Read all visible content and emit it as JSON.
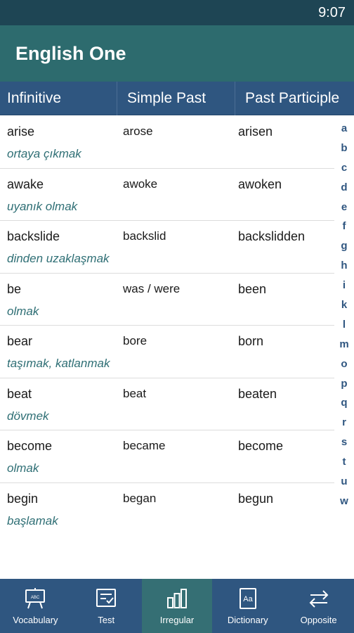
{
  "status_bar": {
    "time": "9:07"
  },
  "app_bar": {
    "title": "English One"
  },
  "columns": {
    "infinitive": "Infinitive",
    "simple_past": "Simple Past",
    "past_participle": "Past Participle"
  },
  "verbs": [
    {
      "infinitive": "arise",
      "simple_past": "arose",
      "past_participle": "arisen",
      "translation": "ortaya çıkmak"
    },
    {
      "infinitive": "awake",
      "simple_past": "awoke",
      "past_participle": "awoken",
      "translation": "uyanık olmak"
    },
    {
      "infinitive": "backslide",
      "simple_past": "backslid",
      "past_participle": "backslidden",
      "translation": "dinden uzaklaşmak"
    },
    {
      "infinitive": "be",
      "simple_past": "was / were",
      "past_participle": "been",
      "translation": "olmak"
    },
    {
      "infinitive": "bear",
      "simple_past": "bore",
      "past_participle": "born",
      "translation": "taşımak, katlanmak"
    },
    {
      "infinitive": "beat",
      "simple_past": "beat",
      "past_participle": "beaten",
      "translation": "dövmek"
    },
    {
      "infinitive": "become",
      "simple_past": "became",
      "past_participle": "become",
      "translation": "olmak"
    },
    {
      "infinitive": "begin",
      "simple_past": "began",
      "past_participle": "begun",
      "translation": "başlamak"
    }
  ],
  "alphabet": [
    "a",
    "b",
    "c",
    "d",
    "e",
    "f",
    "g",
    "h",
    "i",
    "k",
    "l",
    "m",
    "o",
    "p",
    "q",
    "r",
    "s",
    "t",
    "u",
    "w"
  ],
  "bottom_nav": [
    {
      "label": "Vocabulary",
      "icon": "vocabulary-board-icon",
      "active": false
    },
    {
      "label": "Test",
      "icon": "test-checklist-icon",
      "active": false
    },
    {
      "label": "Irregular",
      "icon": "bar-chart-icon",
      "active": true
    },
    {
      "label": "Dictionary",
      "icon": "dictionary-book-icon",
      "active": false
    },
    {
      "label": "Opposite",
      "icon": "swap-arrows-icon",
      "active": false
    }
  ],
  "colors": {
    "status_bar": "#1e4554",
    "app_bar": "#2d6b6e",
    "header": "#2f5680",
    "nav_active": "#356f74",
    "translation_text": "#2f6f75"
  }
}
